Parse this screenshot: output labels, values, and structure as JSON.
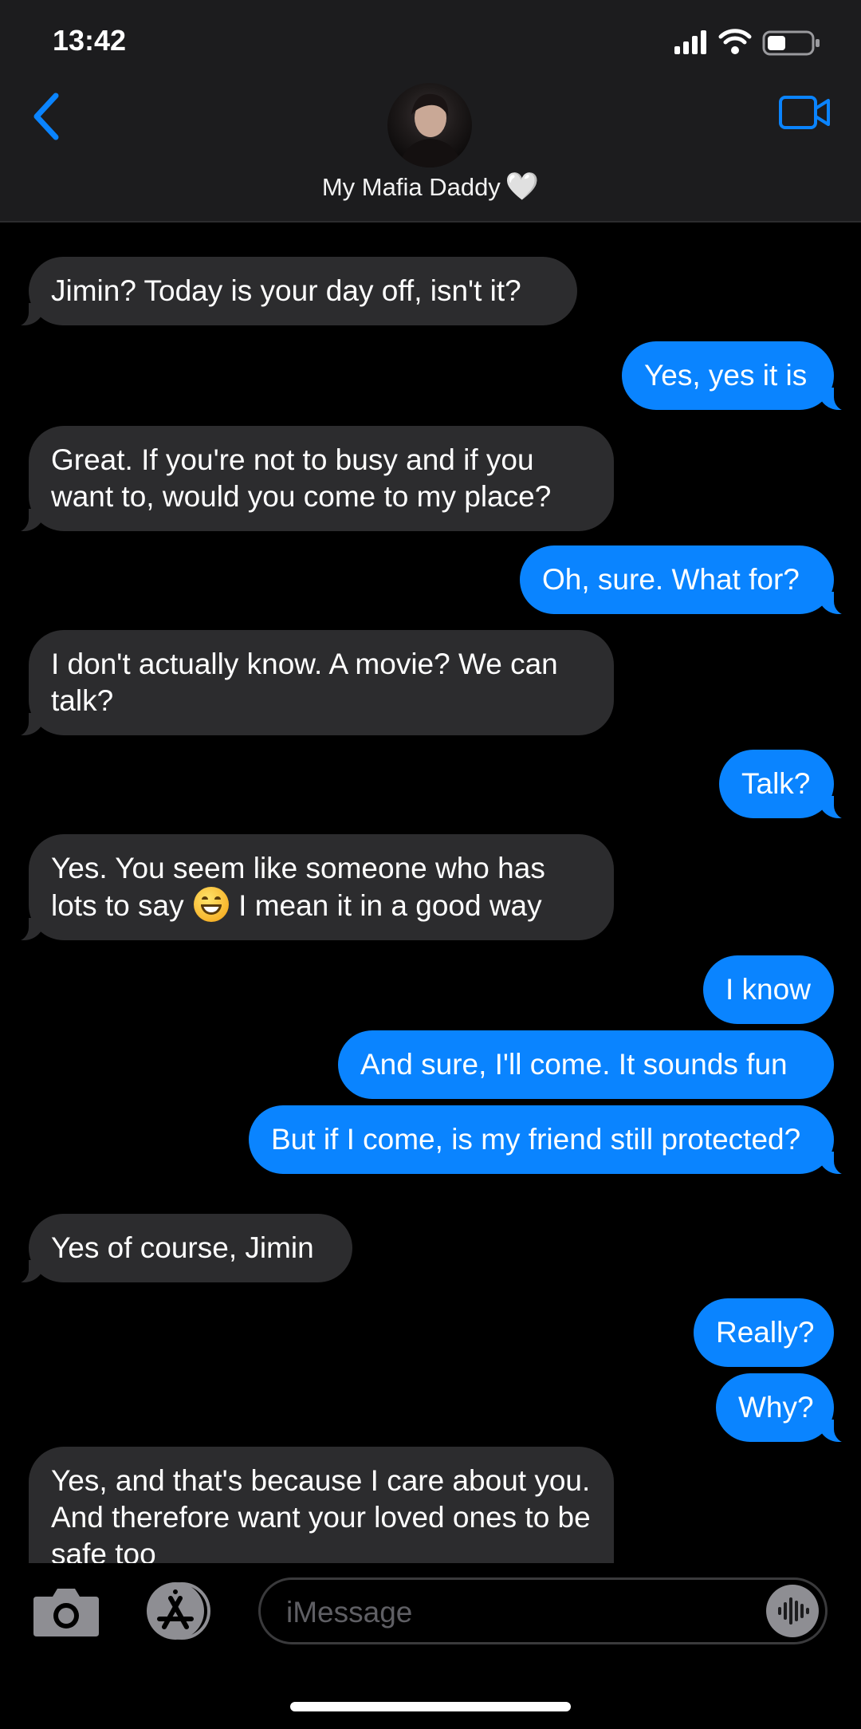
{
  "status_bar": {
    "time": "13:42"
  },
  "header": {
    "contact_name": "My Mafia Daddy",
    "contact_emoji": "🤍"
  },
  "messages": [
    {
      "side": "in",
      "text": "Jimin? Today is your day off, isn't it?"
    },
    {
      "side": "out",
      "text": "Yes, yes it is"
    },
    {
      "side": "in",
      "text": "Great. If you're not to busy and if you want to, would you come to my place?"
    },
    {
      "side": "out",
      "text": "Oh, sure. What for?"
    },
    {
      "side": "in",
      "text": "I don't actually know. A movie? We can talk?"
    },
    {
      "side": "out",
      "text": "Talk?"
    },
    {
      "side": "in",
      "text_before_emoji": "Yes. You seem like someone who has lots to say",
      "emoji": "😁",
      "text_after_emoji": "I mean it in a good way"
    },
    {
      "side": "out",
      "text": "I know"
    },
    {
      "side": "out",
      "text": "And sure, I'll come. It sounds fun"
    },
    {
      "side": "out",
      "text": "But if I come, is my friend still protected?"
    },
    {
      "side": "in",
      "text": "Yes of course, Jimin"
    },
    {
      "side": "out",
      "text": "Really?"
    },
    {
      "side": "out",
      "text": "Why?"
    },
    {
      "side": "in",
      "text": "Yes, and that's because I care about you. And therefore want your loved ones to be safe too"
    }
  ],
  "composer": {
    "placeholder": "iMessage"
  },
  "colors": {
    "accent": "#0a84ff",
    "incoming_bubble": "#2c2c2e",
    "header_background": "#1c1c1e",
    "background": "#000000"
  }
}
